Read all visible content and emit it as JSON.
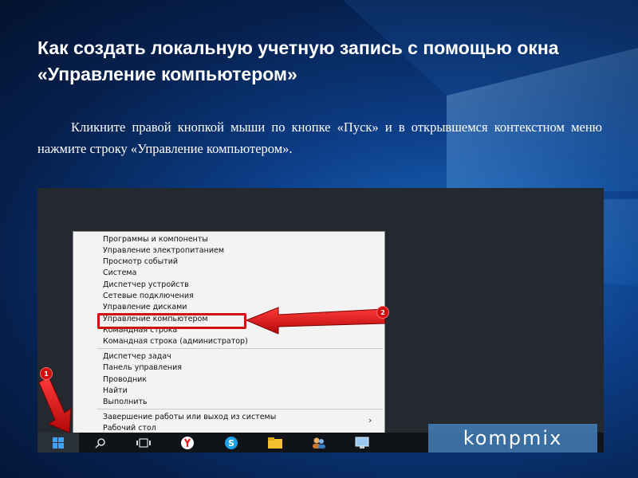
{
  "slide": {
    "title": "Как создать локальную учетную запись с помощью окна «Управление компьютером»",
    "instruction": "Кликните правой кнопкой мыши по кнопке «Пуск» и в открывшемся контекстном меню нажмите строку «Управление компьютером»."
  },
  "context_menu": {
    "items": [
      "Программы и компоненты",
      "Управление электропитанием",
      "Просмотр событий",
      "Система",
      "Диспетчер устройств",
      "Сетевые подключения",
      "Управление дисками",
      "Управление компьютером",
      "Командная строка",
      "Командная строка (администратор)",
      "Диспетчер задач",
      "Панель управления",
      "Проводник",
      "Найти",
      "Выполнить",
      "Завершение работы или выход из системы",
      "Рабочий стол"
    ],
    "highlighted_item": "Управление компьютером"
  },
  "annotations": {
    "step1_badge": "1",
    "step2_badge": "2",
    "accent_color": "#d10f0f"
  },
  "taskbar": {
    "icons": [
      "windows-start-icon",
      "search-icon",
      "task-view-icon",
      "yandex-browser-icon",
      "skype-icon",
      "file-explorer-icon",
      "people-icon",
      "computer-icon"
    ]
  },
  "watermark": {
    "text": "kompmix"
  }
}
